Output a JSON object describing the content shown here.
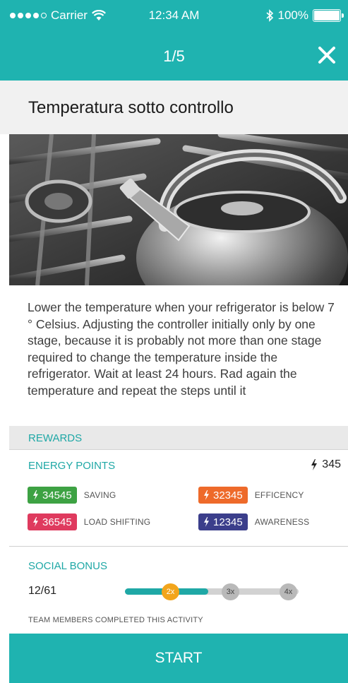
{
  "status_bar": {
    "carrier": "Carrier",
    "time": "12:34 AM",
    "battery": "100%",
    "signal_bars_filled": 4,
    "signal_bars_total": 5
  },
  "nav": {
    "counter": "1/5",
    "close_icon": "close-icon"
  },
  "card": {
    "title": "Temperatura sotto controllo",
    "description": "Lower the temperature when your refrigerator is below 7 ° Celsius. Adjusting the controller initially only by one stage, because it is probably not more than one stage required to change the temperature inside the refrigerator. Wait at least 24 hours. Rad again the temperature and repeat the steps until it"
  },
  "rewards": {
    "header": "REWARDS",
    "energy_points_label": "ENERGY POINTS",
    "energy_points_total": "345",
    "items": [
      {
        "value": "34545",
        "label": "SAVING",
        "color": "#3da243"
      },
      {
        "value": "32345",
        "label": "EFFICENCY",
        "color": "#ee6a2a"
      },
      {
        "value": "36545",
        "label": "LOAD SHIFTING",
        "color": "#df3a5e"
      },
      {
        "value": "12345",
        "label": "AWARENESS",
        "color": "#3b3e8b"
      }
    ]
  },
  "social": {
    "title": "SOCIAL BONUS",
    "count": "12/61",
    "multipliers": [
      "2x",
      "3x",
      "4x"
    ],
    "active_multiplier": "2x",
    "progress_fraction": 0.48,
    "caption": "TEAM MEMBERS COMPLETED THIS ACTIVITY"
  },
  "actions": {
    "start_label": "START"
  },
  "colors": {
    "accent": "#1fb3b0",
    "accent_text": "#1fa8a6",
    "bonus_active": "#f2a51c"
  }
}
